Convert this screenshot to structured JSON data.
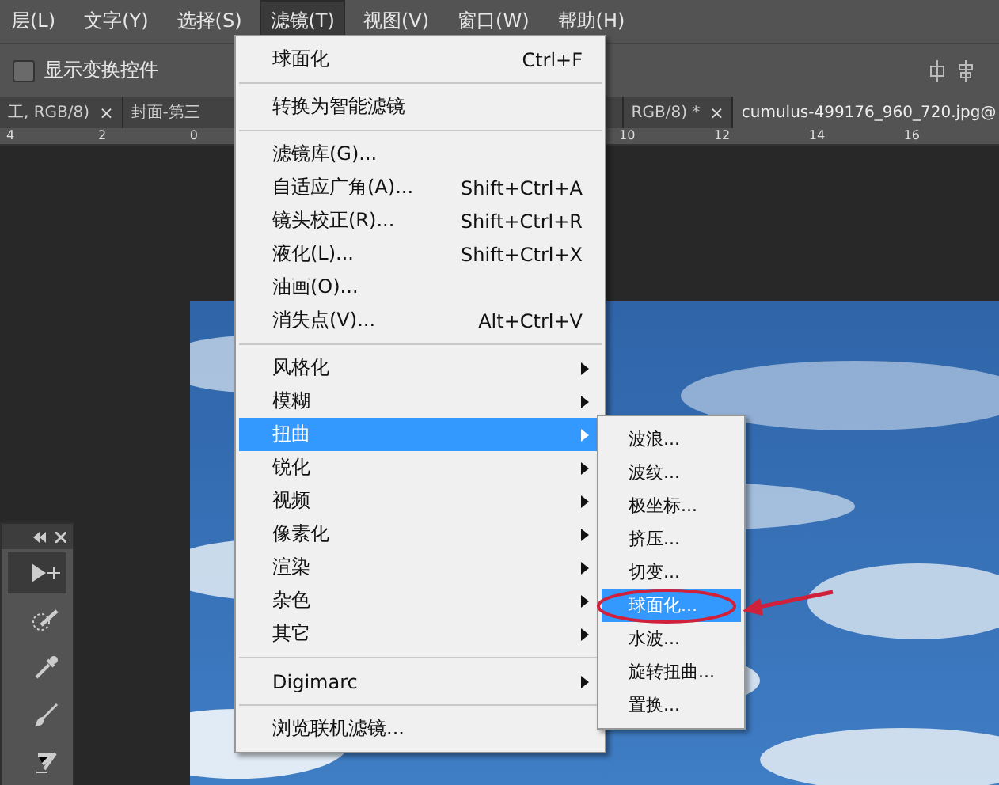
{
  "menu_bar": [
    {
      "label": "层(L)",
      "selected": false
    },
    {
      "label": "文字(Y)",
      "selected": false
    },
    {
      "label": "选择(S)",
      "selected": false
    },
    {
      "label": "滤镜(T)",
      "selected": true
    },
    {
      "label": "视图(V)",
      "selected": false
    },
    {
      "label": "窗口(W)",
      "selected": false
    },
    {
      "label": "帮助(H)",
      "selected": false
    }
  ],
  "options_bar": {
    "checkbox": {
      "label": "显示变换控件",
      "checked": false
    }
  },
  "tabs": [
    {
      "label": "工, RGB/8)",
      "close": "×",
      "selected": false
    },
    {
      "label": "封面-第三",
      "selected": false
    },
    {
      "label": "RGB/8) *",
      "close": "×",
      "selected": false
    },
    {
      "label": "cumulus-499176_960_720.jpg@",
      "selected": true
    }
  ],
  "ruler": {
    "left_labels": [
      "4",
      "2",
      "0"
    ],
    "right_labels": [
      "10",
      "12",
      "14",
      "16"
    ]
  },
  "filter_menu": [
    {
      "kind": "item",
      "label": "球面化",
      "shortcut": "Ctrl+F",
      "submenu": false,
      "selected": false
    },
    {
      "kind": "separator"
    },
    {
      "kind": "item",
      "label": "转换为智能滤镜",
      "submenu": false,
      "selected": false
    },
    {
      "kind": "separator"
    },
    {
      "kind": "item",
      "label": "滤镜库(G)...",
      "submenu": false,
      "selected": false
    },
    {
      "kind": "item",
      "label": "自适应广角(A)...",
      "shortcut": "Shift+Ctrl+A",
      "submenu": false,
      "selected": false
    },
    {
      "kind": "item",
      "label": "镜头校正(R)...",
      "shortcut": "Shift+Ctrl+R",
      "submenu": false,
      "selected": false
    },
    {
      "kind": "item",
      "label": "液化(L)...",
      "shortcut": "Shift+Ctrl+X",
      "submenu": false,
      "selected": false
    },
    {
      "kind": "item",
      "label": "油画(O)...",
      "submenu": false,
      "selected": false
    },
    {
      "kind": "item",
      "label": "消失点(V)...",
      "shortcut": "Alt+Ctrl+V",
      "submenu": false,
      "selected": false
    },
    {
      "kind": "separator"
    },
    {
      "kind": "item",
      "label": "风格化",
      "submenu": true,
      "selected": false
    },
    {
      "kind": "item",
      "label": "模糊",
      "submenu": true,
      "selected": false
    },
    {
      "kind": "item",
      "label": "扭曲",
      "submenu": true,
      "selected": true
    },
    {
      "kind": "item",
      "label": "锐化",
      "submenu": true,
      "selected": false
    },
    {
      "kind": "item",
      "label": "视频",
      "submenu": true,
      "selected": false
    },
    {
      "kind": "item",
      "label": "像素化",
      "submenu": true,
      "selected": false
    },
    {
      "kind": "item",
      "label": "渲染",
      "submenu": true,
      "selected": false
    },
    {
      "kind": "item",
      "label": "杂色",
      "submenu": true,
      "selected": false
    },
    {
      "kind": "item",
      "label": "其它",
      "submenu": true,
      "selected": false
    },
    {
      "kind": "separator"
    },
    {
      "kind": "item",
      "label": "Digimarc",
      "submenu": true,
      "selected": false
    },
    {
      "kind": "separator"
    },
    {
      "kind": "item",
      "label": "浏览联机滤镜...",
      "submenu": false,
      "selected": false
    }
  ],
  "distort_submenu": [
    {
      "label": "波浪...",
      "selected": false
    },
    {
      "label": "波纹...",
      "selected": false
    },
    {
      "label": "极坐标...",
      "selected": false
    },
    {
      "label": "挤压...",
      "selected": false
    },
    {
      "label": "切变...",
      "selected": false
    },
    {
      "label": "球面化...",
      "selected": true
    },
    {
      "label": "水波...",
      "selected": false
    },
    {
      "label": "旋转扭曲...",
      "selected": false
    },
    {
      "label": "置换...",
      "selected": false
    }
  ]
}
